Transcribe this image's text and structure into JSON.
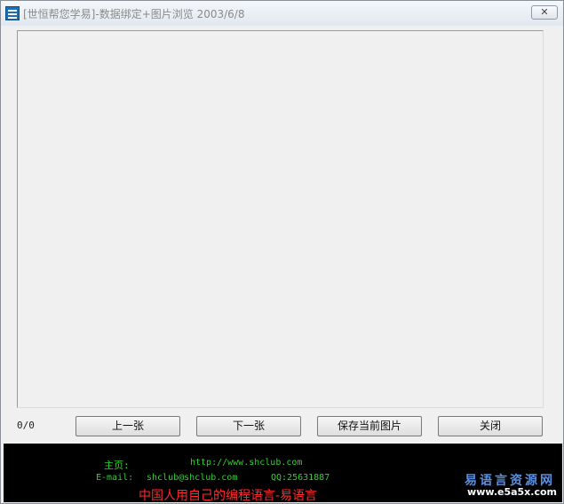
{
  "window": {
    "title": "[世恒帮您学易]-数据绑定+图片浏览  2003/6/8",
    "close_symbol": "✕"
  },
  "viewer": {
    "counter": "0/0"
  },
  "buttons": {
    "prev": "上一张",
    "next": "下一张",
    "save": "保存当前图片",
    "close": "关闭"
  },
  "footer": {
    "home_label": "主页:",
    "home_url": "http://www.shclub.com",
    "email_label": "E-mail:",
    "email_value": "shclub@shclub.com",
    "qq": "QQ:25631887",
    "slogan": "中国人用自己的编程语言-易语言"
  },
  "watermark": {
    "title": "易语言资源网",
    "url": "www.e5a5x.com"
  },
  "colors": {
    "footer_bg": "#000000",
    "footer_text": "#2fd12f",
    "slogan": "#ff2a2a",
    "watermark_title": "#5a8fe0"
  }
}
